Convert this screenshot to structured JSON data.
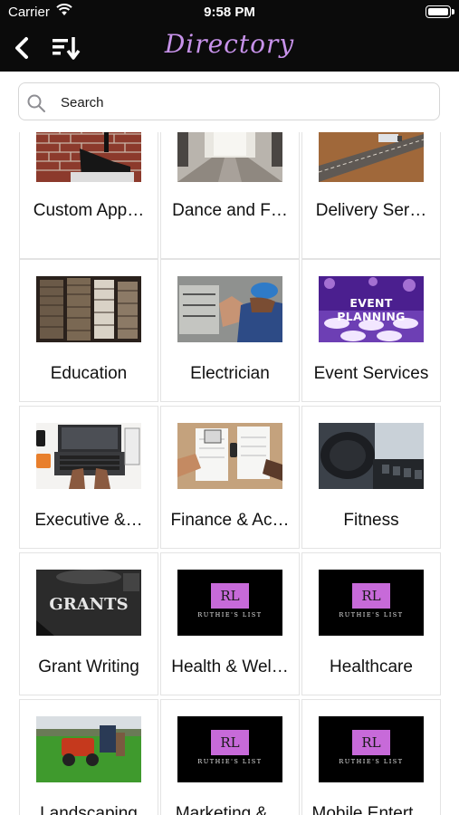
{
  "status_bar": {
    "carrier": "Carrier",
    "time": "9:58 PM"
  },
  "header": {
    "title": "Directory",
    "title_color": "#c792ea",
    "background": "#0b0b0b"
  },
  "search": {
    "placeholder": "Search"
  },
  "logo": {
    "initials": "RL",
    "name": "RUTHIE'S LIST"
  },
  "tiles": [
    {
      "label": "Custom App…",
      "image": "custom-apparel-photo"
    },
    {
      "label": "Dance and F…",
      "image": "dance-studio-photo"
    },
    {
      "label": "Delivery Ser…",
      "image": "delivery-truck-photo"
    },
    {
      "label": "Education",
      "image": "books-photo"
    },
    {
      "label": "Electrician",
      "image": "electrician-photo"
    },
    {
      "label": "Event Services",
      "image": "event-planning-photo",
      "image_text": "EVENT PLANNING"
    },
    {
      "label": "Executive &…",
      "image": "laptop-desk-photo"
    },
    {
      "label": "Finance & Ac…",
      "image": "finance-desk-photo"
    },
    {
      "label": "Fitness",
      "image": "gym-photo"
    },
    {
      "label": "Grant Writing",
      "image": "grants-photo",
      "image_text": "GRANTS"
    },
    {
      "label": "Health & Wel…",
      "image": "ruthies-list-logo"
    },
    {
      "label": "Healthcare",
      "image": "ruthies-list-logo"
    },
    {
      "label": "Landscaping",
      "image": "lawn-mower-photo"
    },
    {
      "label": "Marketing &…",
      "image": "ruthies-list-logo"
    },
    {
      "label": "Mobile Entert…",
      "image": "ruthies-list-logo"
    }
  ]
}
